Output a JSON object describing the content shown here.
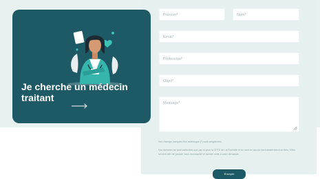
{
  "card": {
    "title_line1": "Je cherche un médecin",
    "title_line2": "traitant"
  },
  "form": {
    "prenom_placeholder": "Prénom*",
    "nom_placeholder": "Nom*",
    "email_placeholder": "Email*",
    "profession_placeholder": "Profession*",
    "objet_placeholder": "Objet*",
    "message_placeholder": "Message*",
    "required_note": "*les champs marqués d'un astérisque (*) sont obligatoires.",
    "privacy_note": "Vos données ne sont collectées que par et pour la CPTS de La Rochelle et ne sont en aucun cas transférées à un tiers. Elles servent afin de pouvoir vous recontacter et donner suite à votre demande.",
    "submit_label": "Envoyer"
  },
  "colors": {
    "brand_dark": "#1e5a66",
    "panel_bg": "#e5f0ef"
  }
}
